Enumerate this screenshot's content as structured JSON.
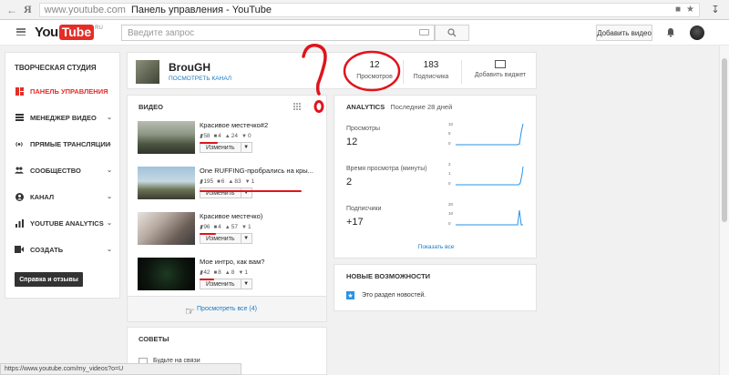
{
  "browser": {
    "url": "www.youtube.com",
    "page_title": "Панель управления - YouTube",
    "yandex": "Я"
  },
  "header": {
    "logo_you": "You",
    "logo_tube": "Tube",
    "logo_region": "RU",
    "search_placeholder": "Введите запрос",
    "upload_label": "Добавить видео"
  },
  "sidebar": {
    "title": "ТВОРЧЕСКАЯ СТУДИЯ",
    "items": [
      {
        "label": "ПАНЕЛЬ УПРАВЛЕНИЯ",
        "icon": "dashboard-icon"
      },
      {
        "label": "МЕНЕДЖЕР ВИДЕО",
        "icon": "video-manager-icon"
      },
      {
        "label": "ПРЯМЫЕ ТРАНСЛЯЦИИ",
        "icon": "live-icon"
      },
      {
        "label": "СООБЩЕСТВО",
        "icon": "community-icon"
      },
      {
        "label": "КАНАЛ",
        "icon": "channel-icon"
      },
      {
        "label": "YOUTUBE ANALYTICS",
        "icon": "analytics-icon"
      },
      {
        "label": "СОЗДАТЬ",
        "icon": "create-icon"
      }
    ],
    "feedback": "Справка и отзывы"
  },
  "channel": {
    "name": "BrouGH",
    "view_link": "ПОСМОТРЕТЬ КАНАЛ",
    "views_value": "12",
    "views_label": "Просмотров",
    "subs_value": "183",
    "subs_label": "Подписчика",
    "widget_label": "Добавить виджет"
  },
  "videos": {
    "title": "ВИДЕО",
    "edit_label": "Изменить",
    "view_all": "Просмотреть все (4)",
    "items": [
      {
        "title": "Красивое местечко#2",
        "views": "58",
        "comments": "4",
        "likes": "24",
        "dislikes": "0"
      },
      {
        "title": "One RUFFING-пробрались на кры...",
        "views": "195",
        "comments": "6",
        "likes": "83",
        "dislikes": "1"
      },
      {
        "title": "Красивое местечко)",
        "views": "96",
        "comments": "4",
        "likes": "57",
        "dislikes": "1"
      },
      {
        "title": "Мое интро, как вам?",
        "views": "42",
        "comments": "8",
        "likes": "8",
        "dislikes": "1"
      }
    ]
  },
  "tips": {
    "title": "СОВЕТЫ",
    "partial": "Будьте на связи"
  },
  "analytics": {
    "title": "ANALYTICS",
    "period": "Последние 28 дней",
    "show_all": "Показать все",
    "metrics": [
      {
        "label": "Просмотры",
        "value": "12",
        "ticks": [
          "10",
          "5",
          "0"
        ]
      },
      {
        "label": "Время просмотра (минуты)",
        "value": "2",
        "ticks": [
          "2",
          "1",
          "0"
        ]
      },
      {
        "label": "Подписчики",
        "value": "+17",
        "ticks": [
          "20",
          "10",
          "0"
        ]
      }
    ]
  },
  "news": {
    "title": "НОВЫЕ ВОЗМОЖНОСТИ",
    "text": "Это раздел новостей."
  },
  "status": {
    "url": "https://www.youtube.com/my_videos?o=U"
  }
}
